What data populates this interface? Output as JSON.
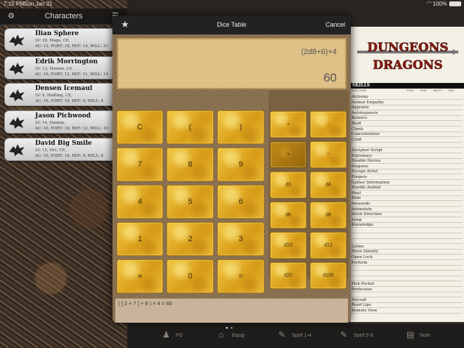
{
  "status": {
    "time": "7:15 PM",
    "date": "Sun Jan 31",
    "battery": "100%"
  },
  "sidebar": {
    "title": "Characters",
    "characters": [
      {
        "name": "Ilian Sphere",
        "line1": "LV: 20, Mage, CE,",
        "line2": "AC: 12, FORT: 18, REF: 14, WILL: 21"
      },
      {
        "name": "Edrik Morrington",
        "line1": "LV: 12, Human, LG,",
        "line2": "AC: 10, FORT: 12, REF: 11, WILL: 14"
      },
      {
        "name": "Densen Icemaul",
        "line1": "LV: 9, Halfling, CE,",
        "line2": "AC: 16, FORT: 10, REF: 9, WILL: 8"
      },
      {
        "name": "Jason Pichwood",
        "line1": "LV: 14, Human,",
        "line2": "AC: 10, FORT: 18, REF: 12, WILL: 10"
      },
      {
        "name": "David Big Smile",
        "line1": "LV: 15, Orc, CE,",
        "line2": "AC: 10, FORT: 16, REF: 9, WILL: 6"
      }
    ]
  },
  "modal": {
    "title": "Dice Table",
    "cancel_label": "Cancel",
    "expression": "(2d8+6)×4",
    "result": "60",
    "history_line": "( [ 2 + 7 ] + 6 ) × 4 = 60",
    "keys": [
      "C",
      "(",
      ")",
      "7",
      "8",
      "9",
      "4",
      "5",
      "6",
      "1",
      "2",
      "3",
      "«",
      "0",
      "="
    ],
    "ops": [
      "+",
      "-",
      "×",
      "÷"
    ],
    "dice": [
      "d3",
      "d4",
      "d6",
      "d8",
      "d10",
      "d12",
      "d20",
      "d100"
    ]
  },
  "sheet": {
    "logo_text_1": "DUNGEONS",
    "logo_text_2": "DRAGONS",
    "skills_header": "SKILLS",
    "col_heads": [
      "SKILL NAME",
      "TOTAL",
      "RANK",
      "ABILITY",
      "MISC"
    ],
    "skills": [
      "Alchemy",
      "Animal Empathy",
      "Appraise",
      "Autohypnosis",
      "Balance",
      "Bluff",
      "Climb",
      "Concentration",
      "Craft",
      "",
      "Decipher Script",
      "Diplomacy",
      "Disable Device",
      "Disguise",
      "Escape Artist",
      "Forgery",
      "Gather Information",
      "Handle Animal",
      "Heal",
      "Hide",
      "Innuendo",
      "Intimidate",
      "Intuit Direction",
      "Jump",
      "Knowledge",
      "",
      "",
      "",
      "Listen",
      "Move Silently",
      "Open Lock",
      "Perform",
      "",
      "",
      "",
      "Pick Pocket",
      "Profession",
      "",
      "Psicraft",
      "Read Lips",
      "Remote View"
    ]
  },
  "tabs": [
    {
      "label": "PG",
      "icon": "person-icon"
    },
    {
      "label": "Equip",
      "icon": "bag-icon"
    },
    {
      "label": "Spell 1-4",
      "icon": "wand-icon"
    },
    {
      "label": "Spell 5-9",
      "icon": "wand-icon"
    },
    {
      "label": "Note",
      "icon": "note-icon"
    }
  ]
}
